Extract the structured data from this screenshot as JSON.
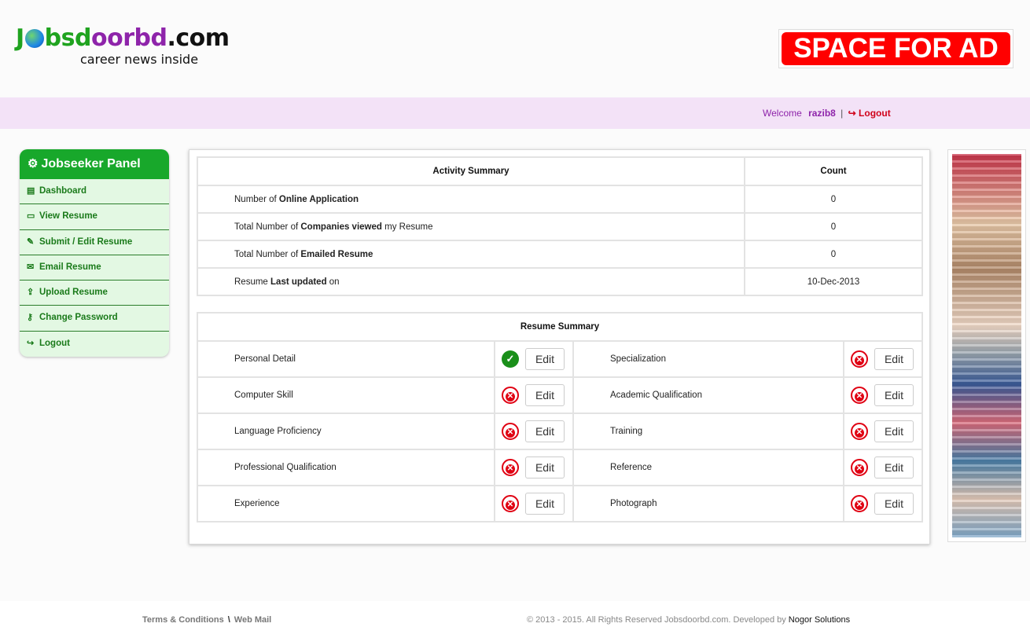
{
  "header": {
    "logo_text": "Jobsdoorbd.com",
    "logo_tagline": "career news inside",
    "ad_text": "SPACE FOR AD"
  },
  "welcome_bar": {
    "welcome": "Welcome",
    "username": "razib8",
    "separator": "|",
    "logout": "Logout"
  },
  "sidebar": {
    "title": "Jobseeker Panel",
    "items": [
      {
        "label": "Dashboard",
        "icon": "dashboard-icon"
      },
      {
        "label": "View Resume",
        "icon": "credit-card-icon"
      },
      {
        "label": "Submit / Edit Resume",
        "icon": "edit-icon"
      },
      {
        "label": "Email Resume",
        "icon": "envelope-icon"
      },
      {
        "label": "Upload Resume",
        "icon": "upload-icon"
      },
      {
        "label": "Change Password",
        "icon": "key-icon"
      },
      {
        "label": "Logout",
        "icon": "sign-out-icon"
      }
    ]
  },
  "activity": {
    "header": "Activity Summary",
    "count_header": "Count",
    "rows": [
      {
        "pre": "Number of ",
        "bold": "Online Application",
        "post": "",
        "count": "0"
      },
      {
        "pre": "Total Number of ",
        "bold": "Companies viewed",
        "post": " my Resume",
        "count": "0"
      },
      {
        "pre": "Total Number of ",
        "bold": "Emailed Resume",
        "post": "",
        "count": "0"
      },
      {
        "pre": "Resume ",
        "bold": "Last updated",
        "post": " on",
        "count": "10-Dec-2013"
      }
    ]
  },
  "resume": {
    "header": "Resume Summary",
    "edit_label": "Edit",
    "rows": [
      {
        "left": "Personal Detail",
        "left_status": "complete",
        "right": "Specialization",
        "right_status": "incomplete"
      },
      {
        "left": "Computer Skill",
        "left_status": "incomplete",
        "right": "Academic Qualification",
        "right_status": "incomplete"
      },
      {
        "left": "Language Proficiency",
        "left_status": "incomplete",
        "right": "Training",
        "right_status": "incomplete"
      },
      {
        "left": "Professional Qualification",
        "left_status": "incomplete",
        "right": "Reference",
        "right_status": "incomplete"
      },
      {
        "left": "Experience",
        "left_status": "incomplete",
        "right": "Photograph",
        "right_status": "incomplete"
      }
    ]
  },
  "footer": {
    "terms": "Terms & Conditions",
    "separator": "\\",
    "webmail": "Web Mail",
    "copyright": "© 2013 - 2015. All Rights Reserved Jobsdoorbd.com. Developed by ",
    "developer": "Nogor Solutions"
  },
  "colors": {
    "panel_green": "#18a82b",
    "welcome_bg": "#f3e2f7",
    "ad_red": "#ff0000",
    "status_ok": "#1a8f1a",
    "status_no": "#e00012"
  }
}
